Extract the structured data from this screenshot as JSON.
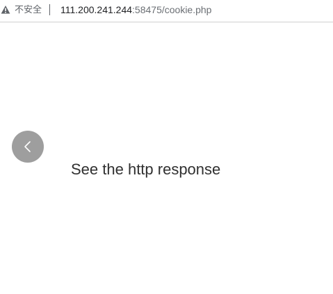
{
  "address_bar": {
    "security_label": "不安全",
    "url_host": "111.200.241.244",
    "url_rest": ":58475/cookie.php",
    "warning_icon": "warning-triangle-icon"
  },
  "back_button": {
    "icon": "chevron-left-icon",
    "color": "#9e9e9e"
  },
  "main": {
    "message": "See the http response"
  }
}
